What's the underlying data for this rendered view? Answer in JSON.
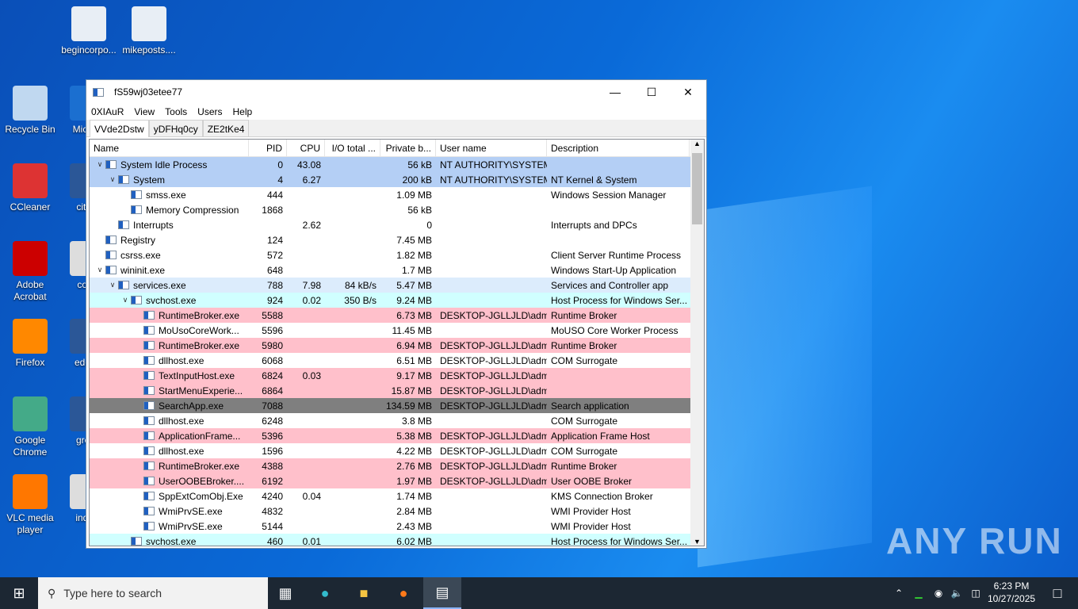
{
  "desktop": {
    "icons": [
      "begincorpo...",
      "mikeposts....",
      "Recycle Bin",
      "CCleaner",
      "Adobe Acrobat",
      "Firefox",
      "Google Chrome",
      "VLC media player",
      "Mic Ed",
      "cities",
      "cove",
      "edcus",
      "greer",
      "indiar"
    ]
  },
  "window": {
    "title": "fS59wj03etee77",
    "menu": [
      "0XIAuR",
      "View",
      "Tools",
      "Users",
      "Help"
    ],
    "tabs": [
      "VVde2Dstw",
      "yDFHq0cy",
      "ZE2tKe4"
    ],
    "columns": [
      "Name",
      "PID",
      "CPU",
      "I/O total ...",
      "Private b...",
      "User name",
      "Description"
    ],
    "rows": [
      [
        "System Idle Process",
        "0",
        "43.08",
        "",
        "56 kB",
        "NT AUTHORITY\\SYSTEM",
        ""
      ],
      [
        "System",
        "4",
        "6.27",
        "",
        "200 kB",
        "NT AUTHORITY\\SYSTEM",
        "NT Kernel & System"
      ],
      [
        "smss.exe",
        "444",
        "",
        "",
        "1.09 MB",
        "",
        "Windows Session Manager"
      ],
      [
        "Memory Compression",
        "1868",
        "",
        "",
        "56 kB",
        "",
        ""
      ],
      [
        "Interrupts",
        "",
        "2.62",
        "",
        "0",
        "",
        "Interrupts and DPCs"
      ],
      [
        "Registry",
        "124",
        "",
        "",
        "7.45 MB",
        "",
        ""
      ],
      [
        "csrss.exe",
        "572",
        "",
        "",
        "1.82 MB",
        "",
        "Client Server Runtime Process"
      ],
      [
        "wininit.exe",
        "648",
        "",
        "",
        "1.7 MB",
        "",
        "Windows Start-Up Application"
      ],
      [
        "services.exe",
        "788",
        "7.98",
        "84 kB/s",
        "5.47 MB",
        "",
        "Services and Controller app"
      ],
      [
        "svchost.exe",
        "924",
        "0.02",
        "350 B/s",
        "9.24 MB",
        "",
        "Host Process for Windows Ser..."
      ],
      [
        "RuntimeBroker.exe",
        "5588",
        "",
        "",
        "6.73 MB",
        "DESKTOP-JGLLJLD\\admi",
        "Runtime Broker"
      ],
      [
        "MoUsoCoreWork...",
        "5596",
        "",
        "",
        "11.45 MB",
        "",
        "MoUSO Core Worker Process"
      ],
      [
        "RuntimeBroker.exe",
        "5980",
        "",
        "",
        "6.94 MB",
        "DESKTOP-JGLLJLD\\admi",
        "Runtime Broker"
      ],
      [
        "dllhost.exe",
        "6068",
        "",
        "",
        "6.51 MB",
        "DESKTOP-JGLLJLD\\admi",
        "COM Surrogate"
      ],
      [
        "TextInputHost.exe",
        "6824",
        "0.03",
        "",
        "9.17 MB",
        "DESKTOP-JGLLJLD\\admi",
        ""
      ],
      [
        "StartMenuExperie...",
        "6864",
        "",
        "",
        "15.87 MB",
        "DESKTOP-JGLLJLD\\admi",
        ""
      ],
      [
        "SearchApp.exe",
        "7088",
        "",
        "",
        "134.59 MB",
        "DESKTOP-JGLLJLD\\admi",
        "Search application"
      ],
      [
        "dllhost.exe",
        "6248",
        "",
        "",
        "3.8 MB",
        "",
        "COM Surrogate"
      ],
      [
        "ApplicationFrame...",
        "5396",
        "",
        "",
        "5.38 MB",
        "DESKTOP-JGLLJLD\\admi",
        "Application Frame Host"
      ],
      [
        "dllhost.exe",
        "1596",
        "",
        "",
        "4.22 MB",
        "DESKTOP-JGLLJLD\\admi",
        "COM Surrogate"
      ],
      [
        "RuntimeBroker.exe",
        "4388",
        "",
        "",
        "2.76 MB",
        "DESKTOP-JGLLJLD\\admi",
        "Runtime Broker"
      ],
      [
        "UserOOBEBroker....",
        "6192",
        "",
        "",
        "1.97 MB",
        "DESKTOP-JGLLJLD\\admi",
        "User OOBE Broker"
      ],
      [
        "SppExtComObj.Exe",
        "4240",
        "0.04",
        "",
        "1.74 MB",
        "",
        "KMS Connection Broker"
      ],
      [
        "WmiPrvSE.exe",
        "4832",
        "",
        "",
        "2.84 MB",
        "",
        "WMI Provider Host"
      ],
      [
        "WmiPrvSE.exe",
        "5144",
        "",
        "",
        "2.43 MB",
        "",
        "WMI Provider Host"
      ],
      [
        "svchost.exe",
        "460",
        "0.01",
        "",
        "6.02 MB",
        "",
        "Host Process for Windows Ser..."
      ]
    ]
  },
  "taskbar": {
    "search_placeholder": "Type here to search",
    "time": "6:23 PM",
    "date": "10/27/2025"
  },
  "watermark": "ANY RUN"
}
